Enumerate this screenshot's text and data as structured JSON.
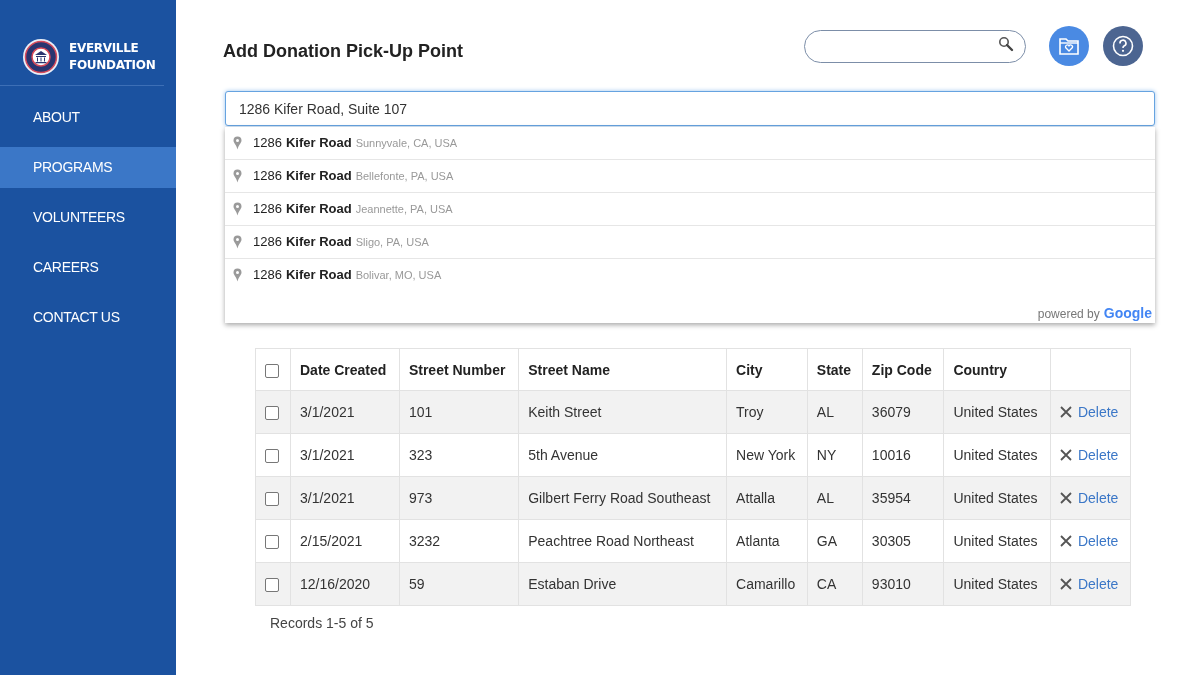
{
  "brand": {
    "line1": "EVERVILLE",
    "line2": "FOUNDATION"
  },
  "sidebar": {
    "items": [
      {
        "label": "ABOUT",
        "selected": false
      },
      {
        "label": "PROGRAMS",
        "selected": true
      },
      {
        "label": "VOLUNTEERS",
        "selected": false
      },
      {
        "label": "CAREERS",
        "selected": false
      },
      {
        "label": "CONTACT US",
        "selected": false
      }
    ]
  },
  "header": {
    "title": "Add Donation Pick-Up Point"
  },
  "address_field": {
    "value": "1286 Kifer Road, Suite 107"
  },
  "suggestions": {
    "items": [
      {
        "number": "1286",
        "street": "Kifer Road",
        "place": "Sunnyvale, CA, USA"
      },
      {
        "number": "1286",
        "street": "Kifer Road",
        "place": "Bellefonte, PA, USA"
      },
      {
        "number": "1286",
        "street": "Kifer Road",
        "place": "Jeannette, PA, USA"
      },
      {
        "number": "1286",
        "street": "Kifer Road",
        "place": "Sligo, PA, USA"
      },
      {
        "number": "1286",
        "street": "Kifer Road",
        "place": "Bolivar, MO, USA"
      }
    ],
    "attribution": "powered by",
    "attribution_brand": "Google"
  },
  "table": {
    "columns": [
      "Date Created",
      "Street Number",
      "Street Name",
      "City",
      "State",
      "Zip Code",
      "Country"
    ],
    "header_checked": false,
    "rows": [
      {
        "checked": false,
        "cells": [
          "3/1/2021",
          "101",
          "Keith Street",
          "Troy",
          "AL",
          "36079",
          "United States"
        ],
        "action": "Delete"
      },
      {
        "checked": false,
        "cells": [
          "3/1/2021",
          "323",
          "5th Avenue",
          "New York",
          "NY",
          "10016",
          "United States"
        ],
        "action": "Delete"
      },
      {
        "checked": false,
        "cells": [
          "3/1/2021",
          "973",
          "Gilbert Ferry Road Southeast",
          "Attalla",
          "AL",
          "35954",
          "United States"
        ],
        "action": "Delete"
      },
      {
        "checked": false,
        "cells": [
          "2/15/2021",
          "3232",
          "Peachtree Road Northeast",
          "Atlanta",
          "GA",
          "30305",
          "United States"
        ],
        "action": "Delete"
      },
      {
        "checked": false,
        "cells": [
          "12/16/2020",
          "59",
          "Estaban Drive",
          "Camarillo",
          "CA",
          "93010",
          "United States"
        ],
        "action": "Delete"
      }
    ]
  },
  "records": "Records 1-5 of 5"
}
